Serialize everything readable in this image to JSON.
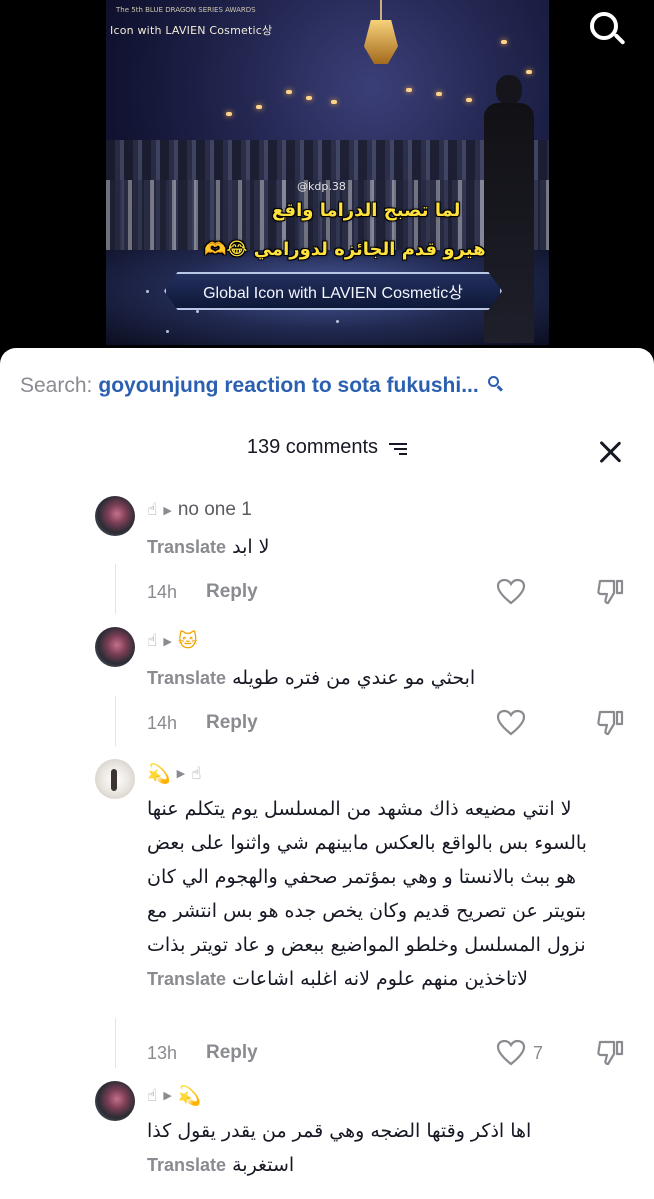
{
  "video": {
    "corner_small_text": "The 5th BLUE DRAGON SERIES AWARDS",
    "corner_text": "Icon with LAVIEN Cosmetic상",
    "watermark": "@kdp.38",
    "caption_line1": "لما تصبح الدراما واقع",
    "caption_line2": "هيرو قدم الجائزه لدورامي 😂🫶",
    "award_banner": "Global Icon with LAVIEN Cosmetic상",
    "search_icon": "search-icon"
  },
  "sheet": {
    "search_label": "Search:",
    "search_query": "goyounjung reaction to sota fukushi...",
    "comments_count": "139 comments",
    "sort_icon": "sort-icon",
    "close_icon": "close-icon"
  },
  "comments": [
    {
      "username": "no one 1",
      "text": "لا ابد",
      "translate_label": "Translate",
      "time": "14h",
      "reply_label": "Reply",
      "likes": ""
    },
    {
      "username": "🐱",
      "text": "ابحثي مو عندي من فتره طويله",
      "translate_label": "Translate",
      "time": "14h",
      "reply_label": "Reply",
      "likes": ""
    },
    {
      "username": "💫",
      "lines": [
        "لا انتي مضيعه ذاك مشهد من المسلسل يوم يتكلم عنها",
        "بالسوء بس بالواقع بالعكس مابينهم شي واثنوا على بعض",
        "هو ببث بالانستا و وهي بمؤتمر صحفي والهجوم الي كان",
        "بتويتر عن تصريح قديم وكان يخص جده هو بس انتشر مع",
        "نزول المسلسل وخلطو المواضيع ببعض و عاد تويتر بذات",
        "لاتاخذين منهم علوم لانه اغلبه اشاعات"
      ],
      "translate_label": "Translate",
      "time": "13h",
      "reply_label": "Reply",
      "likes": "7"
    },
    {
      "username": "💫",
      "lines": [
        "اها اذكر وقتها الضجه وهي قمر من يقدر يقول كذا",
        "استغربة"
      ],
      "translate_label": "Translate"
    }
  ]
}
